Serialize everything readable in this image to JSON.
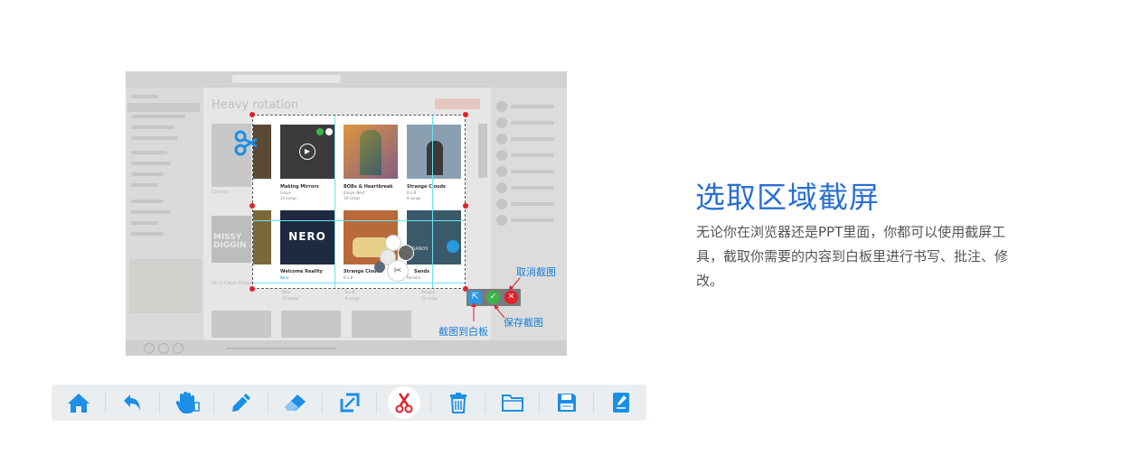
{
  "app_screenshot": {
    "page_title": "Heavy rotation",
    "albums": [
      {
        "title": "Making Mirrors",
        "artist": "Gotye",
        "tracks": "14 songs"
      },
      {
        "title": "BOBs & Heartbreak",
        "artist": "Kanye West",
        "tracks": "18 songs"
      },
      {
        "title": "Strange Clouds",
        "artist": "B.o.B",
        "tracks": "8 songs"
      },
      {
        "title": "Welcome Reality",
        "artist": "Nero",
        "tracks": ""
      },
      {
        "title": "Strange Clouds",
        "artist": "B.o.B",
        "tracks": ""
      },
      {
        "title": "Sands",
        "artist": "Bonobo",
        "tracks": ""
      }
    ],
    "cover_texts": [
      "NERO",
      "SANDS"
    ],
    "below_labels": [
      "Nero",
      "B.o.B",
      "Bonobo",
      "12 songs",
      "8 songs",
      "12 songs"
    ],
    "left_peek_labels": [
      "Chelion",
      "On & Clean Forever",
      "MISSY",
      "DIGGIN"
    ]
  },
  "actions": {
    "cancel_label": "取消截图",
    "save_label": "保存截图",
    "to_board_label": "截图到白板"
  },
  "feature": {
    "title": "选取区域截屏",
    "description": "无论你在浏览器还是PPT里面，你都可以使用截屏工具，截取你需要的内容到白板里进行书写、批注、修改。"
  },
  "toolbar": {
    "tools": [
      "home-icon",
      "undo-icon",
      "hand-icon",
      "pen-icon",
      "eraser-icon",
      "resize-icon",
      "scissors-icon",
      "trash-icon",
      "folder-icon",
      "save-icon",
      "notebook-icon"
    ],
    "active_tool": "scissors-icon"
  },
  "colors": {
    "accent_blue": "#1b8fe6",
    "active_red": "#e0202a",
    "title_blue": "#2a6fd4",
    "toolbar_bg": "#ebeef1"
  }
}
